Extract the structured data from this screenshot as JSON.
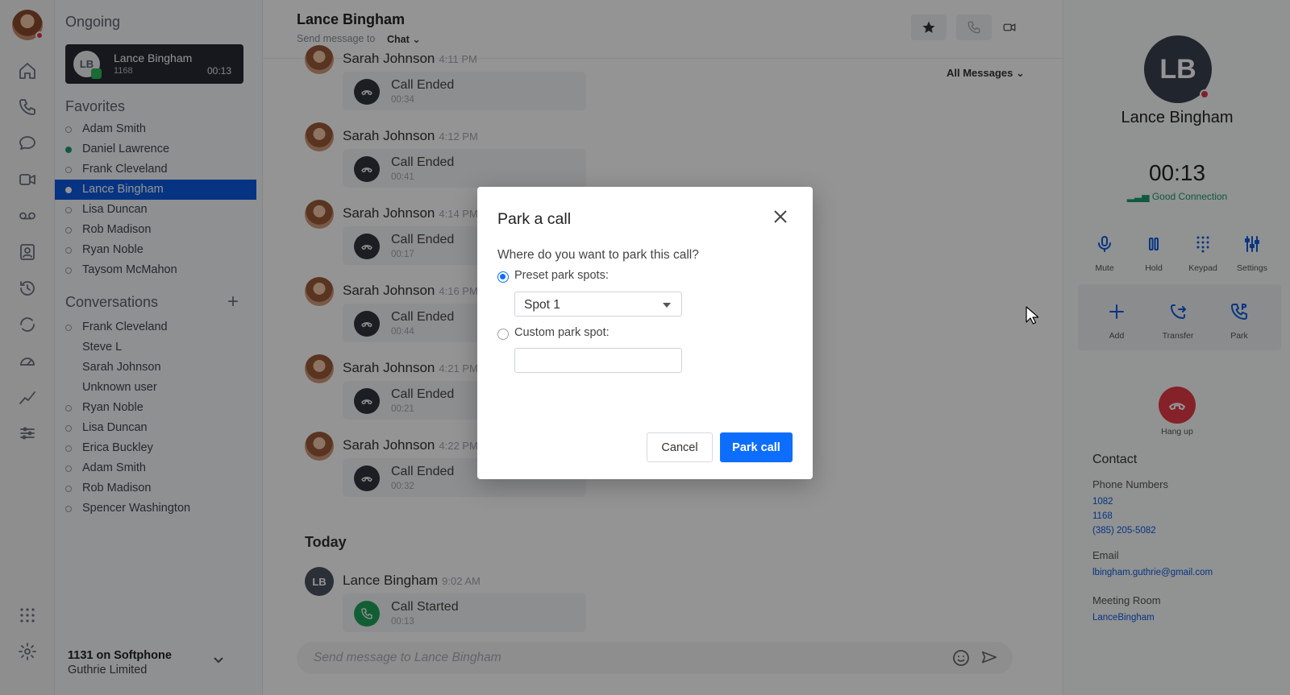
{
  "left_panel": {
    "ongoing_title": "Ongoing",
    "ongoing_call": {
      "initials": "LB",
      "name": "Lance Bingham",
      "ext": "1168",
      "time": "00:13"
    },
    "favorites_title": "Favorites",
    "favorites": [
      {
        "name": "Adam Smith",
        "status": "offline"
      },
      {
        "name": "Daniel Lawrence",
        "status": "online"
      },
      {
        "name": "Frank Cleveland",
        "status": "offline"
      },
      {
        "name": "Lance Bingham",
        "status": "selected"
      },
      {
        "name": "Lisa Duncan",
        "status": "offline"
      },
      {
        "name": "Rob Madison",
        "status": "offline"
      },
      {
        "name": "Ryan Noble",
        "status": "offline"
      },
      {
        "name": "Taysom McMahon",
        "status": "offline"
      }
    ],
    "conversations_title": "Conversations",
    "conversations": [
      {
        "name": "Frank Cleveland",
        "bullet": true
      },
      {
        "name": "Steve L",
        "bullet": false
      },
      {
        "name": "Sarah Johnson",
        "bullet": false
      },
      {
        "name": "Unknown user",
        "bullet": false
      },
      {
        "name": "Ryan Noble",
        "bullet": true
      },
      {
        "name": "Lisa Duncan",
        "bullet": true
      },
      {
        "name": "Erica Buckley",
        "bullet": true
      },
      {
        "name": "Adam Smith",
        "bullet": true
      },
      {
        "name": "Rob Madison",
        "bullet": true
      },
      {
        "name": "Spencer Washington",
        "bullet": true
      }
    ],
    "softphone_line": "1131 on Softphone",
    "softphone_org": "Guthrie Limited"
  },
  "chat": {
    "title": "Lance Bingham",
    "send_to_label": "Send message to",
    "send_to_value": "Chat",
    "filter": "All Messages",
    "messages": [
      {
        "author": "Sarah Johnson",
        "time": "4:11 PM",
        "event": "Call Ended",
        "duration": "00:34"
      },
      {
        "author": "Sarah Johnson",
        "time": "4:12 PM",
        "event": "Call Ended",
        "duration": "00:41"
      },
      {
        "author": "Sarah Johnson",
        "time": "4:14 PM",
        "event": "Call Ended",
        "duration": "00:17"
      },
      {
        "author": "Sarah Johnson",
        "time": "4:16 PM",
        "event": "Call Ended",
        "duration": "00:44"
      },
      {
        "author": "Sarah Johnson",
        "time": "4:21 PM",
        "event": "Call Ended",
        "duration": "00:21"
      },
      {
        "author": "Sarah Johnson",
        "time": "4:22 PM",
        "event": "Call Ended",
        "duration": "00:32"
      }
    ],
    "today_label": "Today",
    "today_message": {
      "initials": "LB",
      "author": "Lance Bingham",
      "time": "9:02 AM",
      "event": "Call Started",
      "duration": "00:13"
    },
    "composer_placeholder": "Send message to Lance Bingham"
  },
  "right_panel": {
    "initials": "LB",
    "name": "Lance Bingham",
    "timer": "00:13",
    "connection": "Good Connection",
    "controls": {
      "mute": "Mute",
      "hold": "Hold",
      "keypad": "Keypad",
      "settings": "Settings",
      "add": "Add",
      "transfer": "Transfer",
      "park": "Park"
    },
    "hangup": "Hang up",
    "contact_title": "Contact",
    "phone_label": "Phone Numbers",
    "phones": [
      "1082",
      "1168",
      "(385) 205-5082"
    ],
    "email_label": "Email",
    "email": "lbingham.guthrie@gmail.com",
    "meeting_label": "Meeting Room",
    "meeting": "LanceBingham"
  },
  "modal": {
    "title": "Park a call",
    "question": "Where do you want to park this call?",
    "preset_label": "Preset park spots:",
    "preset_value": "Spot 1",
    "custom_label": "Custom park spot:",
    "custom_value": "",
    "cancel": "Cancel",
    "park": "Park call"
  },
  "colors": {
    "accent": "#0d6efd",
    "selected": "#0d5be0",
    "online": "#1d9a6c",
    "hangup": "#e53945"
  }
}
